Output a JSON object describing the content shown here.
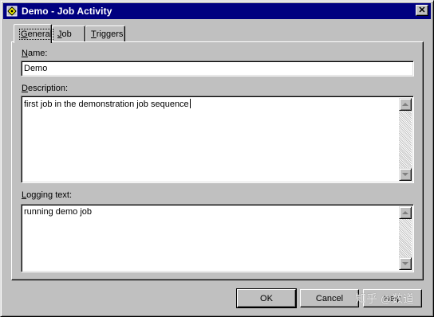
{
  "window": {
    "title": "Demo - Job Activity",
    "icon": "job-activity-icon",
    "close_icon": "close-icon"
  },
  "tabs": [
    {
      "label_first": "G",
      "label_rest": "eneral",
      "active": true
    },
    {
      "label_first": "J",
      "label_rest": "ob",
      "active": false
    },
    {
      "label_first": "T",
      "label_rest": "riggers",
      "active": false
    }
  ],
  "fields": {
    "name": {
      "label_first": "N",
      "label_rest": "ame:",
      "value": "Demo"
    },
    "description": {
      "label_first": "D",
      "label_rest": "escription:",
      "value": "first job in the demonstration job sequence"
    },
    "logging": {
      "label_first": "L",
      "label_rest": "ogging text:",
      "value": "running demo job"
    }
  },
  "buttons": {
    "ok": "OK",
    "cancel": "Cancel",
    "help": "Help"
  },
  "watermark": "知乎 @数道",
  "colors": {
    "titlebar": "#000080",
    "face": "#c0c0c0",
    "desktop": "#808080"
  }
}
